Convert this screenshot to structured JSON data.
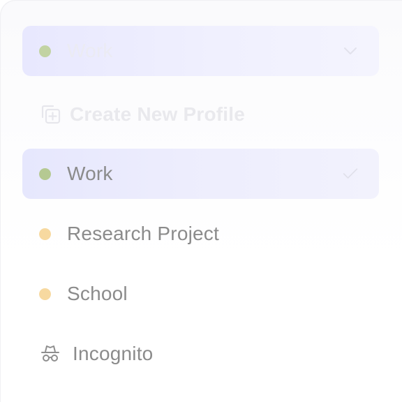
{
  "profile_switcher": {
    "current_profile": {
      "label": "Work",
      "color": "#c2d3a3",
      "icon": "chevron-down-icon"
    },
    "create_new": {
      "label": "Create New Profile",
      "icon": "add-profile-icon"
    },
    "profiles": [
      {
        "label": "Work",
        "color": "#b5c992",
        "selected": true,
        "icon": "checkmark-icon"
      },
      {
        "label": "Research Project",
        "color": "#f7d9a0",
        "selected": false
      },
      {
        "label": "School",
        "color": "#f7d9a0",
        "selected": false
      }
    ],
    "incognito": {
      "label": "Incognito",
      "icon": "incognito-icon"
    },
    "colors": {
      "highlight": "#e6e7fd",
      "text": "#8b8b8b"
    }
  }
}
